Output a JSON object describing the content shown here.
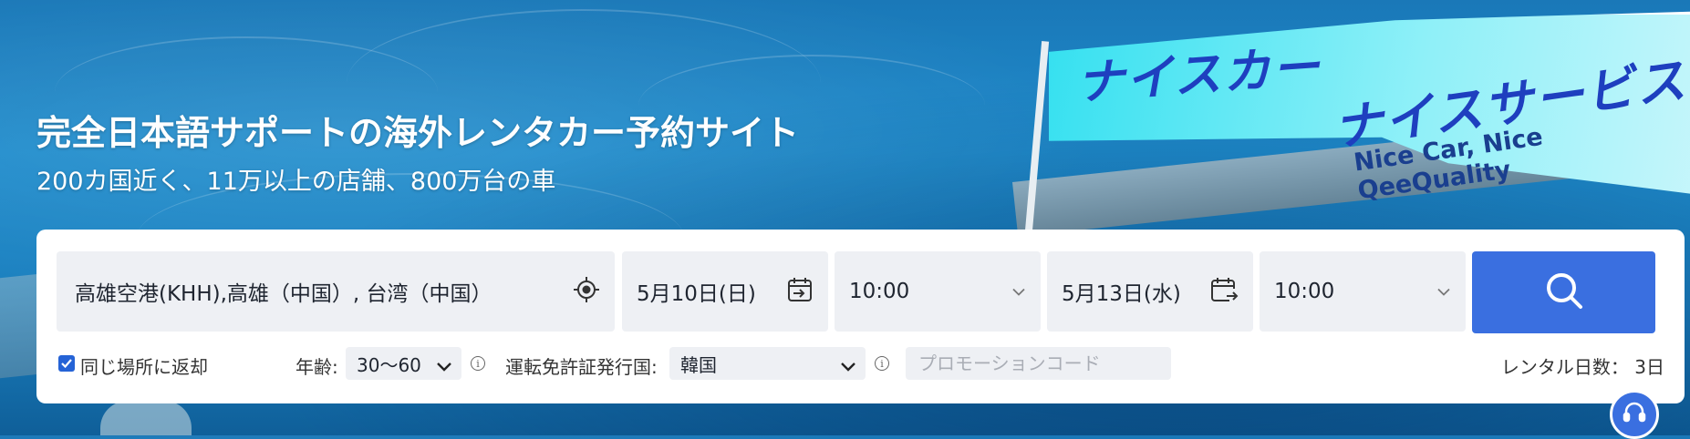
{
  "hero": {
    "title": "完全日本語サポートの海外レンタカー予約サイト",
    "subtitle": "200カ国近く、11万以上の店舗、800万台の車",
    "banner_line1": "ナイスカー",
    "banner_line2": "ナイスサービス",
    "banner_line3": "Nice Car,  Nice QeeQuality"
  },
  "search": {
    "pickup_location": "高雄空港(KHH),高雄（中国）, 台湾（中国）",
    "pickup_date": "5月10日(日)",
    "pickup_time": "10:00",
    "dropoff_date": "5月13日(水)",
    "dropoff_time": "10:00"
  },
  "options": {
    "same_location_label": "同じ場所に返却",
    "same_location_checked": true,
    "age_label": "年齢:",
    "age_value": "30〜60",
    "license_label": "運転免許証発行国:",
    "license_value": "韓国",
    "promo_placeholder": "プロモーションコード",
    "rental_days": "レンタル日数： 3日"
  },
  "icons": {
    "locate": "crosshair-icon",
    "pickup_calendar": "calendar-in-icon",
    "dropoff_calendar": "calendar-out-icon",
    "chevron": "chevron-down-icon",
    "search": "search-icon",
    "info": "info-icon",
    "support": "headset-icon"
  },
  "colors": {
    "primary": "#3a6fe0",
    "field_bg": "#eef0f4"
  }
}
